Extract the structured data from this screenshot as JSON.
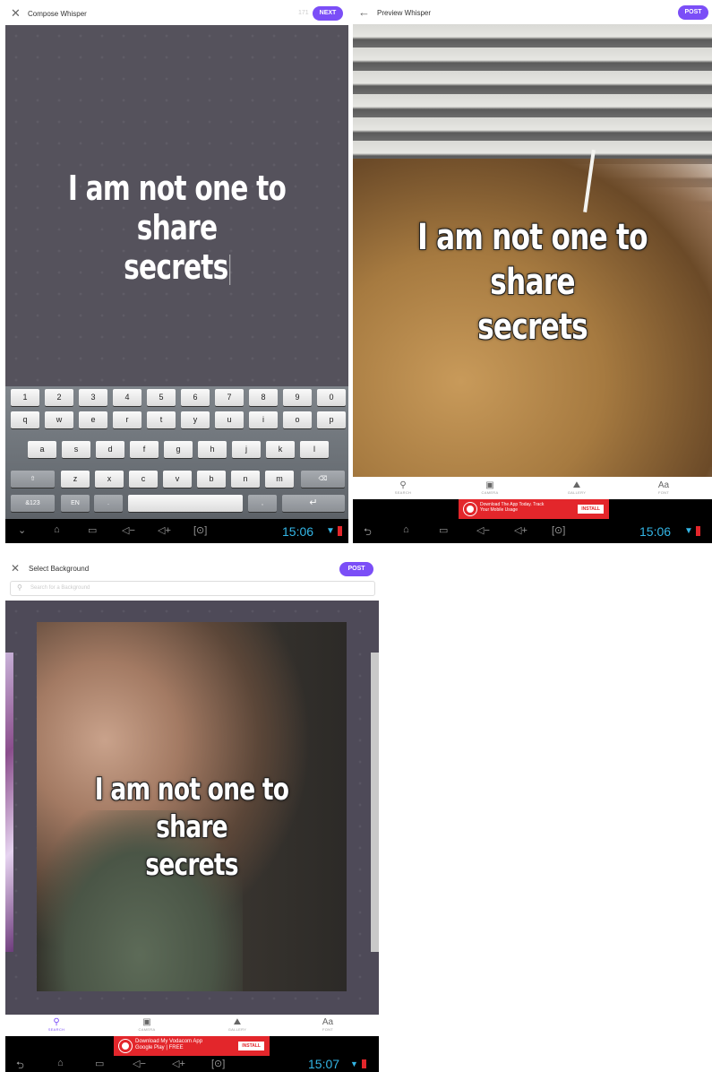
{
  "compose": {
    "header": {
      "title": "Compose Whisper",
      "counter": "171",
      "next_label": "NEXT"
    },
    "whisper_text": [
      "I am not one to share",
      "secrets"
    ],
    "keyboard": {
      "row1": [
        "1",
        "2",
        "3",
        "4",
        "5",
        "6",
        "7",
        "8",
        "9",
        "0"
      ],
      "row2": [
        "q",
        "w",
        "e",
        "r",
        "t",
        "y",
        "u",
        "i",
        "o",
        "p"
      ],
      "row3": [
        "a",
        "s",
        "d",
        "f",
        "g",
        "h",
        "j",
        "k",
        "l"
      ],
      "row4": [
        "z",
        "x",
        "c",
        "v",
        "b",
        "n",
        "m"
      ],
      "symbols_label": "&123",
      "lang_label": "EN",
      "period": ".",
      "comma": ","
    },
    "clock": "15:06"
  },
  "preview": {
    "header": {
      "title": "Preview Whisper",
      "post_label": "POST"
    },
    "whisper_text": [
      "I am not one to share",
      "secrets"
    ],
    "tools": [
      {
        "icon": "search-icon",
        "label": "SEARCH"
      },
      {
        "icon": "camera-icon",
        "label": "CAMERA"
      },
      {
        "icon": "gallery-icon",
        "label": "GALLERY"
      },
      {
        "icon": "font-icon",
        "label": "FONT"
      }
    ],
    "ad": {
      "text_line1": "Download The App Today. Track",
      "text_line2": "Your Mobile Usage",
      "install_label": "INSTALL"
    },
    "clock": "15:06"
  },
  "background": {
    "header": {
      "title": "Select Background",
      "post_label": "POST"
    },
    "search_placeholder": "Search for a Background",
    "whisper_text": [
      "I am not one to share",
      "secrets"
    ],
    "tools": [
      {
        "icon": "search-icon",
        "label": "SEARCH"
      },
      {
        "icon": "camera-icon",
        "label": "CAMERA"
      },
      {
        "icon": "gallery-icon",
        "label": "GALLERY"
      },
      {
        "icon": "font-icon",
        "label": "FONT"
      }
    ],
    "ad": {
      "text_line1": "Download My Vodacom App",
      "text_line2": "Google Play | FREE",
      "install_label": "INSTALL"
    },
    "clock": "15:07"
  },
  "colors": {
    "accent": "#7b4ef7",
    "compose_bg": "#55525c",
    "clock": "#33b5e5",
    "ad_red": "#e3262b"
  }
}
